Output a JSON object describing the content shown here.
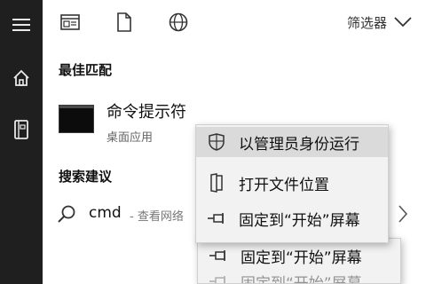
{
  "sidebar": {
    "icons": [
      "hamburger-menu-icon",
      "home-icon",
      "notebook-icon"
    ]
  },
  "toolbar": {
    "icons": [
      "apps-icon",
      "documents-icon",
      "web-icon"
    ],
    "filter_label": "筛选器"
  },
  "best_match": {
    "section_title": "最佳匹配",
    "app_name": "命令提示符",
    "app_type": "桌面应用"
  },
  "suggestions": {
    "section_title": "搜索建议",
    "term": "cmd",
    "description": "- 查看网络"
  },
  "context_menu": {
    "items": [
      {
        "label": "以管理员身份运行",
        "icon": "shield-icon",
        "highlighted": true
      },
      {
        "label": "打开文件位置",
        "icon": "folder-icon",
        "highlighted": false
      },
      {
        "label": "固定到“开始”屏幕",
        "icon": "pin-icon",
        "highlighted": false
      }
    ]
  },
  "context_menu_duplicate": {
    "items": [
      {
        "label": "固定到“开始”屏幕",
        "icon": "pin-icon"
      },
      {
        "label": "固定到“开始”屏幕",
        "icon": "pin-icon"
      }
    ]
  },
  "colors": {
    "rail_bg": "#1f1f1f",
    "menu_bg": "#f2f2f2",
    "menu_highlight": "#dadada"
  }
}
